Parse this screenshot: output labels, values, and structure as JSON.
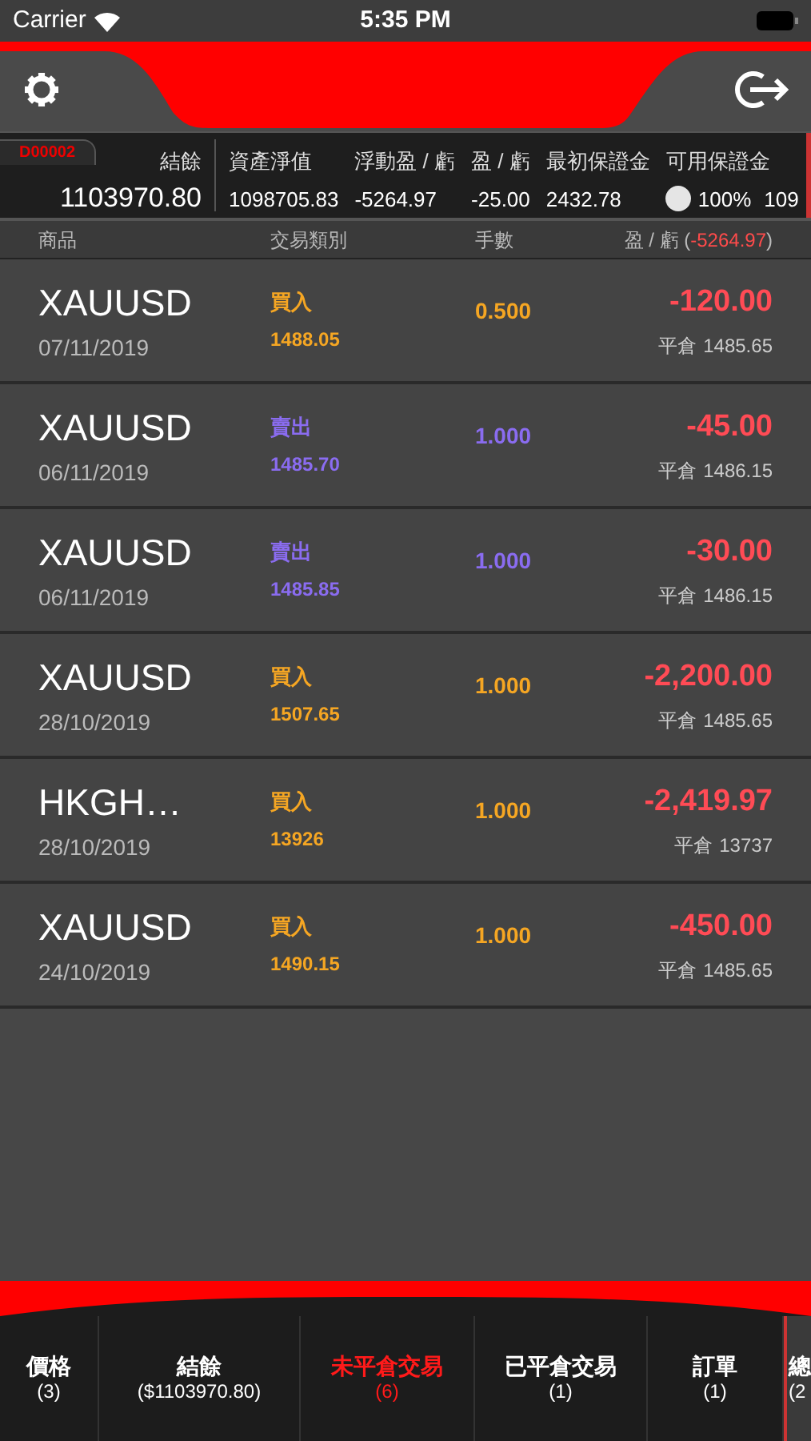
{
  "status_bar": {
    "carrier": "Carrier",
    "time": "5:35 PM"
  },
  "account": {
    "id": "D00002",
    "balance_label": "結餘",
    "balance": "1103970.80",
    "stats": [
      {
        "label": "資產淨值",
        "value": "1098705.83"
      },
      {
        "label": "浮動盈 / 虧",
        "value": "-5264.97"
      },
      {
        "label": "盈 / 虧",
        "value": "-25.00"
      },
      {
        "label": "最初保證金",
        "value": "2432.78"
      },
      {
        "label": "可用保證金",
        "value": "100%",
        "extra": "109",
        "kind": "meter"
      }
    ]
  },
  "columns": {
    "product": "商品",
    "type": "交易類別",
    "lots": "手數",
    "pl_label": "盈 / 虧 (",
    "pl_total": "-5264.97",
    "pl_close": ")"
  },
  "trades": [
    {
      "symbol": "XAUUSD",
      "date": "07/11/2019",
      "kind": "buy",
      "type": "買入",
      "price": "1488.05",
      "lots": "0.500",
      "pl": "-120.00",
      "close_label": "平倉",
      "close_price": "1485.65"
    },
    {
      "symbol": "XAUUSD",
      "date": "06/11/2019",
      "kind": "sell",
      "type": "賣出",
      "price": "1485.70",
      "lots": "1.000",
      "pl": "-45.00",
      "close_label": "平倉",
      "close_price": "1486.15"
    },
    {
      "symbol": "XAUUSD",
      "date": "06/11/2019",
      "kind": "sell",
      "type": "賣出",
      "price": "1485.85",
      "lots": "1.000",
      "pl": "-30.00",
      "close_label": "平倉",
      "close_price": "1486.15"
    },
    {
      "symbol": "XAUUSD",
      "date": "28/10/2019",
      "kind": "buy",
      "type": "買入",
      "price": "1507.65",
      "lots": "1.000",
      "pl": "-2,200.00",
      "close_label": "平倉",
      "close_price": "1485.65"
    },
    {
      "symbol": "HKGH…",
      "date": "28/10/2019",
      "kind": "buy",
      "type": "買入",
      "price": "13926",
      "lots": "1.000",
      "pl": "-2,419.97",
      "close_label": "平倉",
      "close_price": "13737"
    },
    {
      "symbol": "XAUUSD",
      "date": "24/10/2019",
      "kind": "buy",
      "type": "買入",
      "price": "1490.15",
      "lots": "1.000",
      "pl": "-450.00",
      "close_label": "平倉",
      "close_price": "1485.65"
    }
  ],
  "tabs": [
    {
      "label": "價格",
      "count": "(3)",
      "selected": false
    },
    {
      "label": "結餘",
      "count": "($1103970.80)",
      "selected": false
    },
    {
      "label": "未平倉交易",
      "count": "(6)",
      "selected": true
    },
    {
      "label": "已平倉交易",
      "count": "(1)",
      "selected": false
    },
    {
      "label": "訂單",
      "count": "(1)",
      "selected": false
    },
    {
      "label": "總",
      "count": "(2",
      "selected": false
    }
  ]
}
